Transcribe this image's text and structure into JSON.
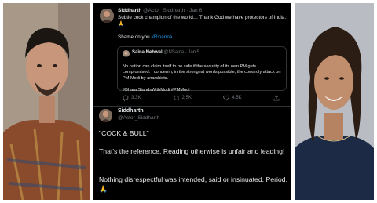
{
  "tweet1": {
    "name": "Siddharth",
    "handle": "@Actor_Siddharth",
    "date": "· Jan 6",
    "text": "Subtle cock champion of the world… Thank God we have protectors of India. 🙏",
    "line2_prefix": "Shame on you ",
    "hashtag": "#Rihanna",
    "quoted": {
      "name": "Saina Nehwal",
      "handle": "@NSaina · Jan 5",
      "text": "No nation can claim itself to be safe if the security of its own PM gets compromised. I condemn, in the strongest words possible, the cowardly attack on PM Modi by anarchists.",
      "hashtags": "#BharatStandsWithModi #PMModi"
    },
    "actions": {
      "reply": "3.3K",
      "retweet": "2.5K",
      "like": "4.5K"
    }
  },
  "tweet2": {
    "name": "Siddharth",
    "handle": "@Actor_Siddharth",
    "para1": "\"COCK & BULL\"",
    "para2": "That's the reference. Reading otherwise is unfair and leading!",
    "para3": "Nothing disrespectful was intended, said or insinuated. Period. 🙏"
  },
  "colors": {
    "background": "#000000",
    "text": "#e7e9ea",
    "muted": "#71767b",
    "link": "#1d9bf0",
    "border": "#2f3336"
  }
}
